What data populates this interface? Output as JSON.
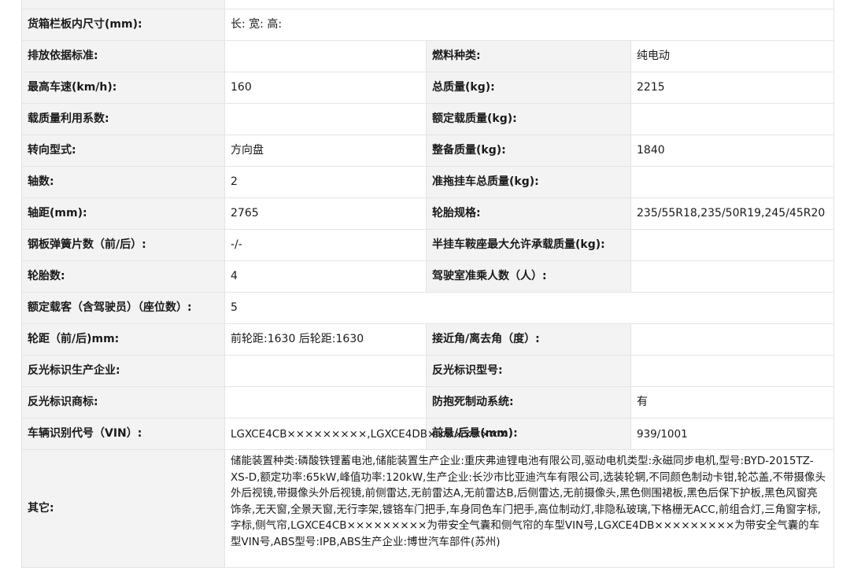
{
  "rows": [
    {
      "label": "货箱栏板内尺寸(mm):",
      "value": "长:  宽:  高:"
    },
    {
      "l1": "排放依据标准:",
      "v1": "",
      "l2": "燃料种类:",
      "v2": "纯电动"
    },
    {
      "l1": "最高车速(km/h):",
      "v1": "160",
      "l2": "总质量(kg):",
      "v2": "2215"
    },
    {
      "l1": "载质量利用系数:",
      "v1": "",
      "l2": "额定载质量(kg):",
      "v2": ""
    },
    {
      "l1": "转向型式:",
      "v1": "方向盘",
      "l2": "整备质量(kg):",
      "v2": "1840"
    },
    {
      "l1": "轴数:",
      "v1": "2",
      "l2": "准拖挂车总质量(kg):",
      "v2": ""
    },
    {
      "l1": "轴距(mm):",
      "v1": "2765",
      "l2": "轮胎规格:",
      "v2": "235/55R18,235/50R19,245/45R20"
    },
    {
      "l1": "钢板弹簧片数（前/后）:",
      "v1": "-/-",
      "l2": "半挂车鞍座最大允许承载质量(kg):",
      "v2": ""
    },
    {
      "l1": "轮胎数:",
      "v1": "4",
      "l2": "驾驶室准乘人数（人）:",
      "v2": ""
    },
    {
      "label": "额定载客（含驾驶员）（座位数）:",
      "value": "5"
    },
    {
      "l1": "轮距（前/后)mm:",
      "v1": "前轮距:1630 后轮距:1630",
      "l2": "接近角/离去角（度）:",
      "v2": ""
    },
    {
      "l1": "反光标识生产企业:",
      "v1": "",
      "l2": "反光标识型号:",
      "v2": ""
    },
    {
      "l1": "反光标识商标:",
      "v1": "",
      "l2": "防抱死制动系统:",
      "v2": "有"
    },
    {
      "l1": "车辆识别代号（VIN）:",
      "v1": "LGXCE4CB×××××××××,LGXCE4DB×××××××××",
      "l2": "前悬/后悬(mm):",
      "v2": "939/1001"
    }
  ],
  "other": {
    "label": "其它:",
    "value": "储能装置种类:磷酸铁锂蓄电池,储能装置生产企业:重庆弗迪锂电池有限公司,驱动电机类型:永磁同步电机,型号:BYD-2015TZ-XS-D,额定功率:65kW,峰值功率:120kW,生产企业:长沙市比亚迪汽车有限公司,选装轮辋,不同颜色制动卡钳,轮芯盖,不带摄像头外后视镜,带摄像头外后视镜,前侧雷达,无前雷达A,无前雷达B,后侧雷达,无前摄像头,黑色侧围裙板,黑色后保下护板,黑色风窗亮饰条,无天窗,全景天窗,无行李架,镀铬车门把手,车身同色车门把手,高位制动灯,非隐私玻璃,下格栅无ACC,前组合灯,三角窗字标,字标,侧气帘,LGXCE4CB×××××××××为带安全气囊和侧气帘的车型VIN号,LGXCE4DB×××××××××为带安全气囊的车型VIN号,ABS型号:IPB,ABS生产企业:博世汽车部件(苏州)"
  }
}
